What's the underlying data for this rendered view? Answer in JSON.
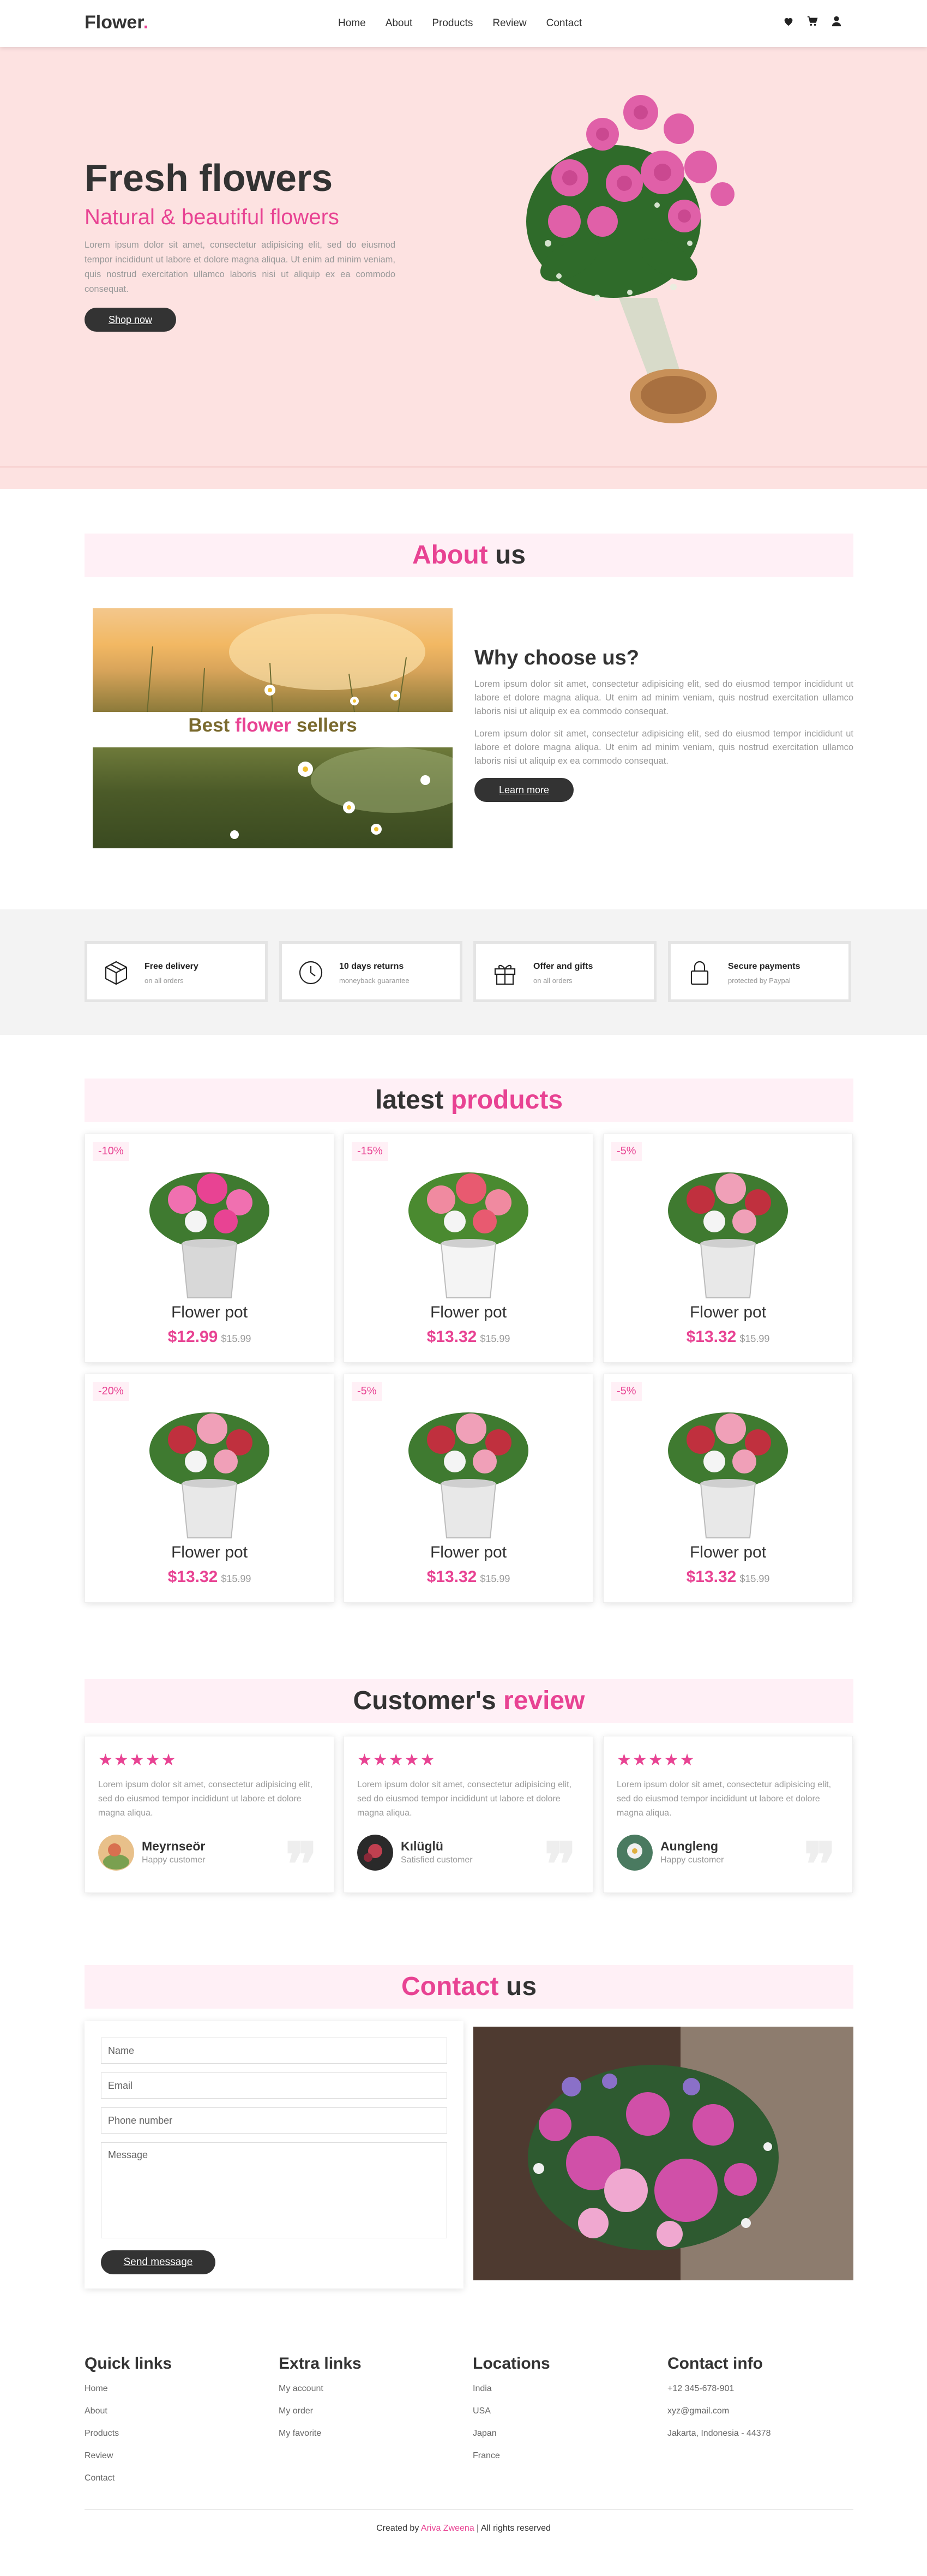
{
  "header": {
    "logo": "Flower",
    "logo_dot": ".",
    "nav": [
      "Home",
      "About",
      "Products",
      "Review",
      "Contact"
    ],
    "icons": [
      "heart-icon",
      "cart-icon",
      "user-icon"
    ]
  },
  "hero": {
    "title": "Fresh flowers",
    "subtitle": "Natural & beautiful flowers",
    "text": "Lorem ipsum dolor sit amet, consectetur adipisicing elit, sed do eiusmod tempor incididunt ut labore et dolore magna aliqua. Ut enim ad minim veniam, quis nostrud exercitation ullamco laboris nisi ut aliquip ex ea commodo consequat.",
    "button": "Shop now"
  },
  "about": {
    "heading_pink": "About",
    "heading_dark": " us",
    "caption_a": "Best ",
    "caption_pink": "flower",
    "caption_b": " sellers",
    "title": "Why choose us?",
    "p1": "Lorem ipsum dolor sit amet, consectetur adipisicing elit, sed do eiusmod tempor incididunt ut labore et dolore magna aliqua. Ut enim ad minim veniam, quis nostrud exercitation ullamco laboris nisi ut aliquip ex ea commodo consequat.",
    "p2": "Lorem ipsum dolor sit amet, consectetur adipisicing elit, sed do eiusmod tempor incididunt ut labore et dolore magna aliqua. Ut enim ad minim veniam, quis nostrud exercitation ullamco laboris nisi ut aliquip ex ea commodo consequat.",
    "button": "Learn more"
  },
  "features": [
    {
      "icon": "box-icon",
      "title": "Free delivery",
      "sub": "on all orders"
    },
    {
      "icon": "clock-icon",
      "title": "10 days returns",
      "sub": "moneyback guarantee"
    },
    {
      "icon": "gift-icon",
      "title": "Offer and gifts",
      "sub": "on all orders"
    },
    {
      "icon": "lock-icon",
      "title": "Secure payments",
      "sub": "protected by Paypal"
    }
  ],
  "products": {
    "heading_dark": "latest ",
    "heading_pink": "products",
    "items": [
      {
        "badge": "-10%",
        "name": "Flower pot",
        "price": "$12.99",
        "old": "$15.99"
      },
      {
        "badge": "-15%",
        "name": "Flower pot",
        "price": "$13.32",
        "old": "$15.99"
      },
      {
        "badge": "-5%",
        "name": "Flower pot",
        "price": "$13.32",
        "old": "$15.99"
      },
      {
        "badge": "-20%",
        "name": "Flower pot",
        "price": "$13.32",
        "old": "$15.99"
      },
      {
        "badge": "-5%",
        "name": "Flower pot",
        "price": "$13.32",
        "old": "$15.99"
      },
      {
        "badge": "-5%",
        "name": "Flower pot",
        "price": "$13.32",
        "old": "$15.99"
      }
    ]
  },
  "reviews": {
    "heading_dark": "Customer's ",
    "heading_pink": "review",
    "items": [
      {
        "stars": "★★★★★",
        "text": "Lorem ipsum dolor sit amet, consectetur adipisicing elit, sed do eiusmod tempor incididunt ut labore et dolore magna aliqua.",
        "name": "Meyrnseör",
        "role": "Happy customer"
      },
      {
        "stars": "★★★★★",
        "text": "Lorem ipsum dolor sit amet, consectetur adipisicing elit, sed do eiusmod tempor incididunt ut labore et dolore magna aliqua.",
        "name": "Kılüglü",
        "role": "Satisfied customer"
      },
      {
        "stars": "★★★★★",
        "text": "Lorem ipsum dolor sit amet, consectetur adipisicing elit, sed do eiusmod tempor incididunt ut labore et dolore magna aliqua.",
        "name": "Aungleng",
        "role": "Happy customer"
      }
    ],
    "quote_mark": "❞"
  },
  "contact": {
    "heading_pink": "Contact",
    "heading_dark": " us",
    "name_ph": "Name",
    "email_ph": "Email",
    "phone_ph": "Phone number",
    "message_ph": "Message",
    "button": "Send message"
  },
  "footer": {
    "quick": {
      "title": "Quick links",
      "links": [
        "Home",
        "About",
        "Products",
        "Review",
        "Contact"
      ]
    },
    "extra": {
      "title": "Extra links",
      "links": [
        "My account",
        "My order",
        "My favorite"
      ]
    },
    "locations": {
      "title": "Locations",
      "links": [
        "India",
        "USA",
        "Japan",
        "France"
      ]
    },
    "info": {
      "title": "Contact info",
      "links": [
        "+12 345-678-901",
        "xyz@gmail.com",
        "Jakarta, Indonesia - 44378"
      ]
    },
    "credit_a": "Created by ",
    "credit_name": "Ariva Zweena",
    "credit_b": " | All rights reserved"
  },
  "colors": {
    "accent": "#e84393",
    "dark": "#333333",
    "hero_bg": "#fde2e1",
    "band_bg": "#fff0f6"
  }
}
